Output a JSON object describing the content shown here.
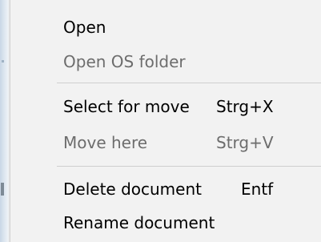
{
  "context_menu": {
    "items": [
      {
        "label": "Open",
        "shortcut": "",
        "enabled": true
      },
      {
        "label": "Open OS folder",
        "shortcut": "",
        "enabled": false
      },
      {
        "label": "Select for move",
        "shortcut": "Strg+X",
        "enabled": true
      },
      {
        "label": "Move here",
        "shortcut": "Strg+V",
        "enabled": false
      },
      {
        "label": "Delete document",
        "shortcut": "Entf",
        "enabled": true
      },
      {
        "label": "Rename document",
        "shortcut": "",
        "enabled": true
      }
    ]
  },
  "colors": {
    "menu_background": "#f2f2f2",
    "enabled_text": "#000000",
    "disabled_text": "#6d6d6d",
    "separator": "#cfcfcf"
  }
}
